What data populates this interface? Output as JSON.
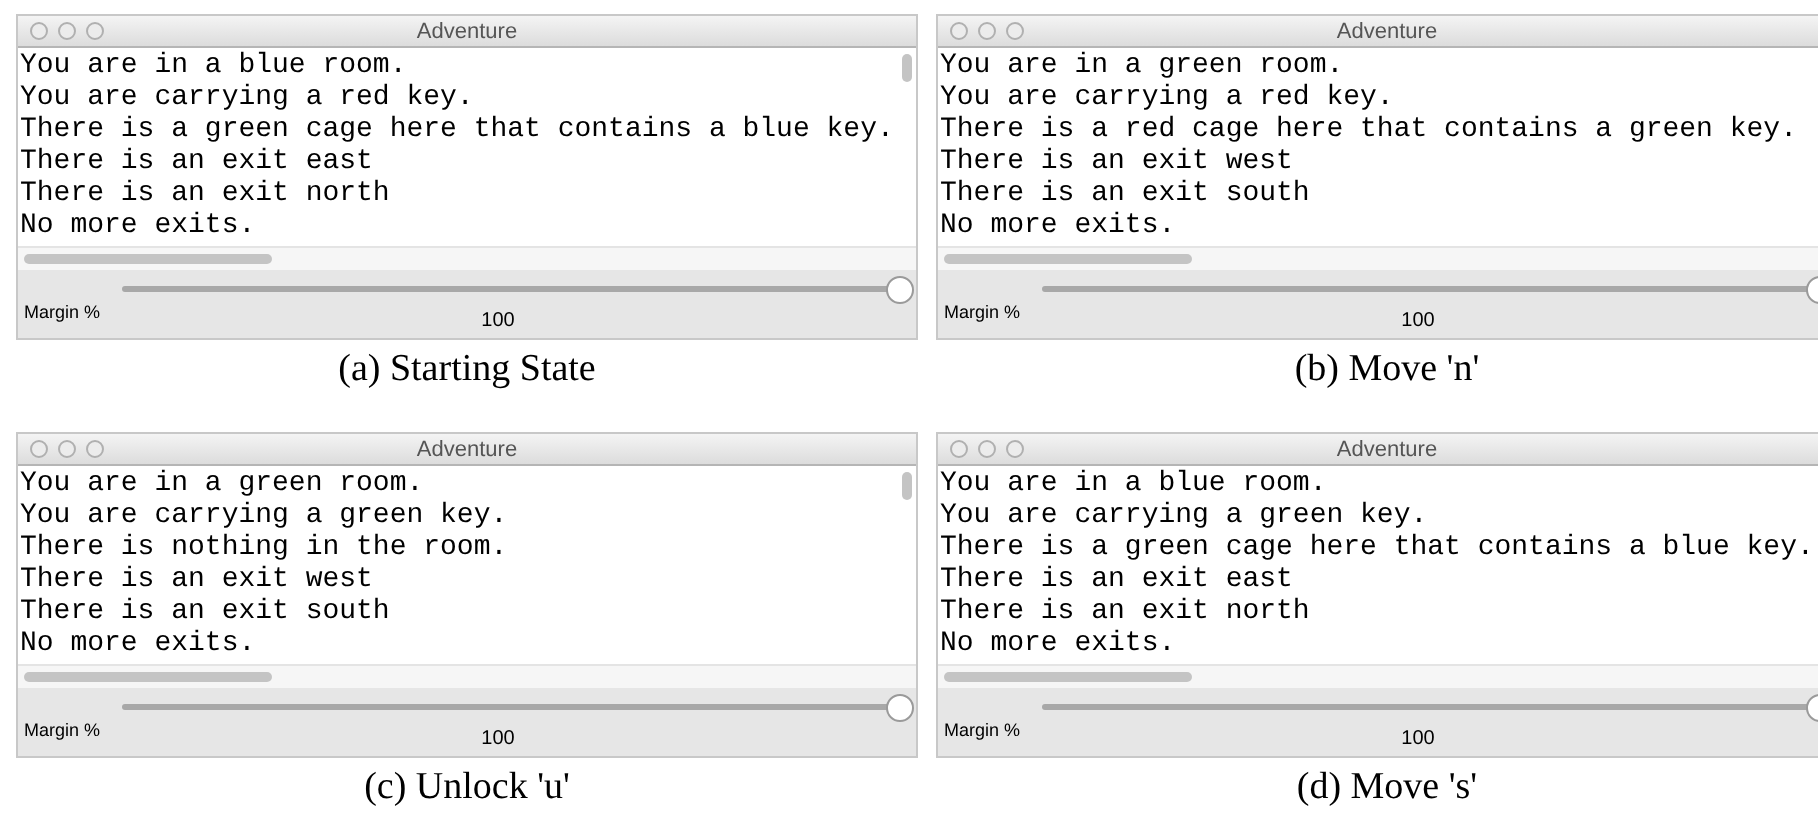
{
  "panels": [
    {
      "window": {
        "title": "Adventure",
        "lines": [
          "You are in a blue room.",
          "You are carrying a red key.",
          "There is a green cage here that contains a blue key.",
          "There is an exit east",
          "There is an exit north",
          "No more exits."
        ],
        "slider": {
          "label": "Margin %",
          "level": 1,
          "reading": "100"
        }
      },
      "caption": "(a) Starting State"
    },
    {
      "window": {
        "title": "Adventure",
        "lines": [
          "You are in a green room.",
          "You are carrying a red key.",
          "There is a red cage here that contains a green key.",
          "There is an exit west",
          "There is an exit south",
          "No more exits."
        ],
        "slider": {
          "label": "Margin %",
          "level": 1,
          "reading": "100"
        }
      },
      "caption": "(b) Move 'n'"
    },
    {
      "window": {
        "title": "Adventure",
        "lines": [
          "You are in a green room.",
          "You are carrying a green key.",
          "There is nothing in the room.",
          "There is an exit west",
          "There is an exit south",
          "No more exits."
        ],
        "slider": {
          "label": "Margin %",
          "level": 1,
          "reading": "100"
        }
      },
      "caption": "(c) Unlock 'u'"
    },
    {
      "window": {
        "title": "Adventure",
        "lines": [
          "You are in a blue room.",
          "You are carrying a green key.",
          "There is a green cage here that contains a blue key.",
          "There is an exit east",
          "There is an exit north",
          "No more exits."
        ],
        "slider": {
          "label": "Margin %",
          "level": 1,
          "reading": "100"
        }
      },
      "caption": "(d) Move 's'"
    }
  ]
}
